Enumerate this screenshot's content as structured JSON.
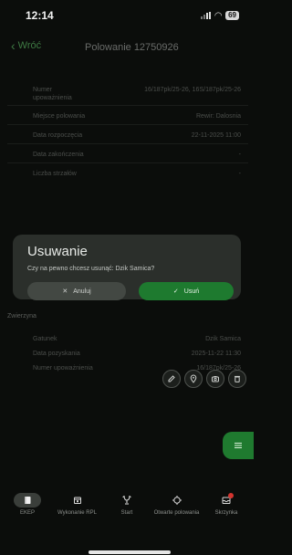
{
  "status": {
    "time": "12:14",
    "battery": "69"
  },
  "header": {
    "back_label": "Wróć",
    "title": "Polowanie 12750926"
  },
  "details": {
    "rows": [
      {
        "label": "Numer upoważnienia",
        "value": "16/187pk/25-26, 16S/187pk/25-26"
      },
      {
        "label": "Miejsce polowania",
        "value": "Rewir: Dalosnia"
      },
      {
        "label": "Data rozpoczęcia",
        "value": "22-11-2025 11:00"
      },
      {
        "label": "Data zakończenia",
        "value": "-"
      },
      {
        "label": "Liczba strzałów",
        "value": "-"
      }
    ]
  },
  "dialog": {
    "title": "Usuwanie",
    "message": "Czy na pewno chcesz usunąć: Dzik Samica?",
    "cancel_label": "Anuluj",
    "confirm_label": "Usuń"
  },
  "game": {
    "section_title": "Zwierzyna",
    "rows": [
      {
        "label": "Gatunek",
        "value": "Dzik Samica"
      },
      {
        "label": "Data pozyskania",
        "value": "2025-11-22 11:30"
      },
      {
        "label": "Numer upoważnienia",
        "value": "16/187pk/25-26"
      }
    ],
    "actions": [
      "edit-icon",
      "location-pin-icon",
      "camera-icon",
      "trash-icon"
    ]
  },
  "tabs": [
    {
      "label": "EKEP",
      "icon": "book-icon",
      "active": true
    },
    {
      "label": "Wykonanie RPL",
      "icon": "calendar-icon",
      "active": false
    },
    {
      "label": "Start",
      "icon": "trophy-icon",
      "active": false
    },
    {
      "label": "Otwarte polowania",
      "icon": "target-icon",
      "active": false
    },
    {
      "label": "Skrzynka",
      "icon": "inbox-icon",
      "badge": "",
      "active": false
    }
  ],
  "colors": {
    "accent": "#1e7a2f",
    "background": "#0b0d0b",
    "dialog": "#2b2f2b"
  }
}
